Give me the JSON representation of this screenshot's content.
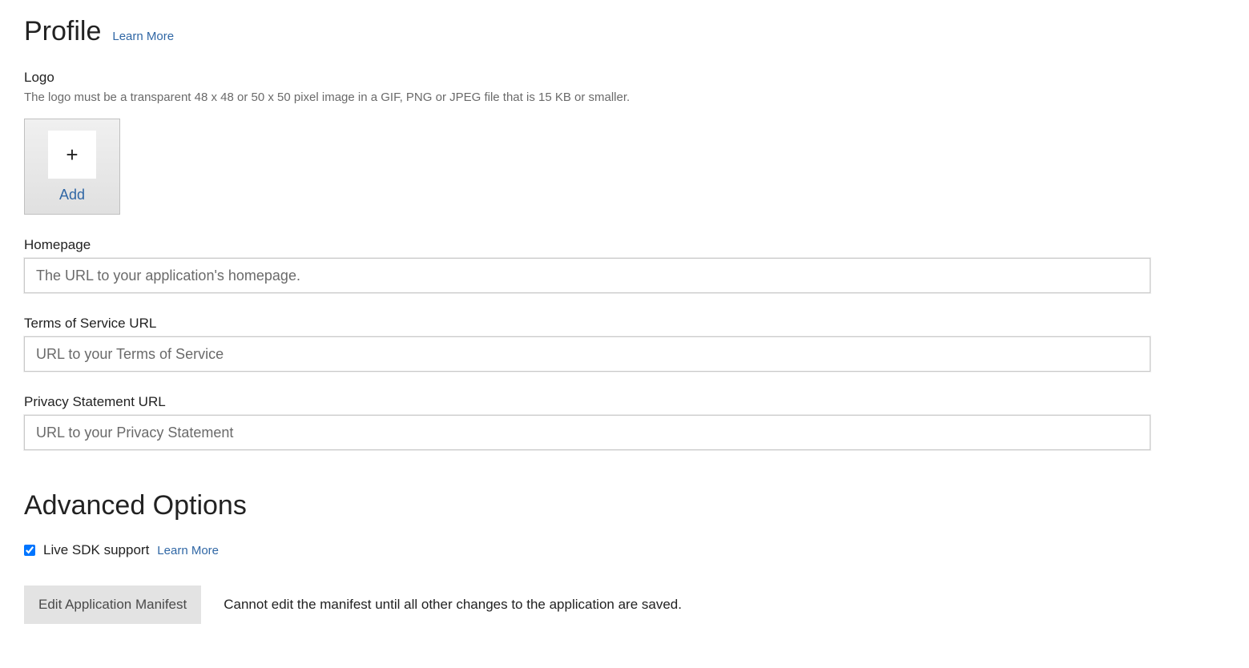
{
  "profile": {
    "title": "Profile",
    "learn_more": "Learn More",
    "logo": {
      "label": "Logo",
      "help": "The logo must be a transparent 48 x 48 or 50 x 50 pixel image in a GIF, PNG or JPEG file that is 15 KB or smaller.",
      "add_label": "Add"
    },
    "homepage": {
      "label": "Homepage",
      "placeholder": "The URL to your application's homepage.",
      "value": ""
    },
    "tos": {
      "label": "Terms of Service URL",
      "placeholder": "URL to your Terms of Service",
      "value": ""
    },
    "privacy": {
      "label": "Privacy Statement URL",
      "placeholder": "URL to your Privacy Statement",
      "value": ""
    }
  },
  "advanced": {
    "title": "Advanced Options",
    "live_sdk": {
      "label": "Live SDK support",
      "checked": true,
      "learn_more": "Learn More"
    },
    "manifest": {
      "button": "Edit Application Manifest",
      "note": "Cannot edit the manifest until all other changes to the application are saved."
    }
  }
}
